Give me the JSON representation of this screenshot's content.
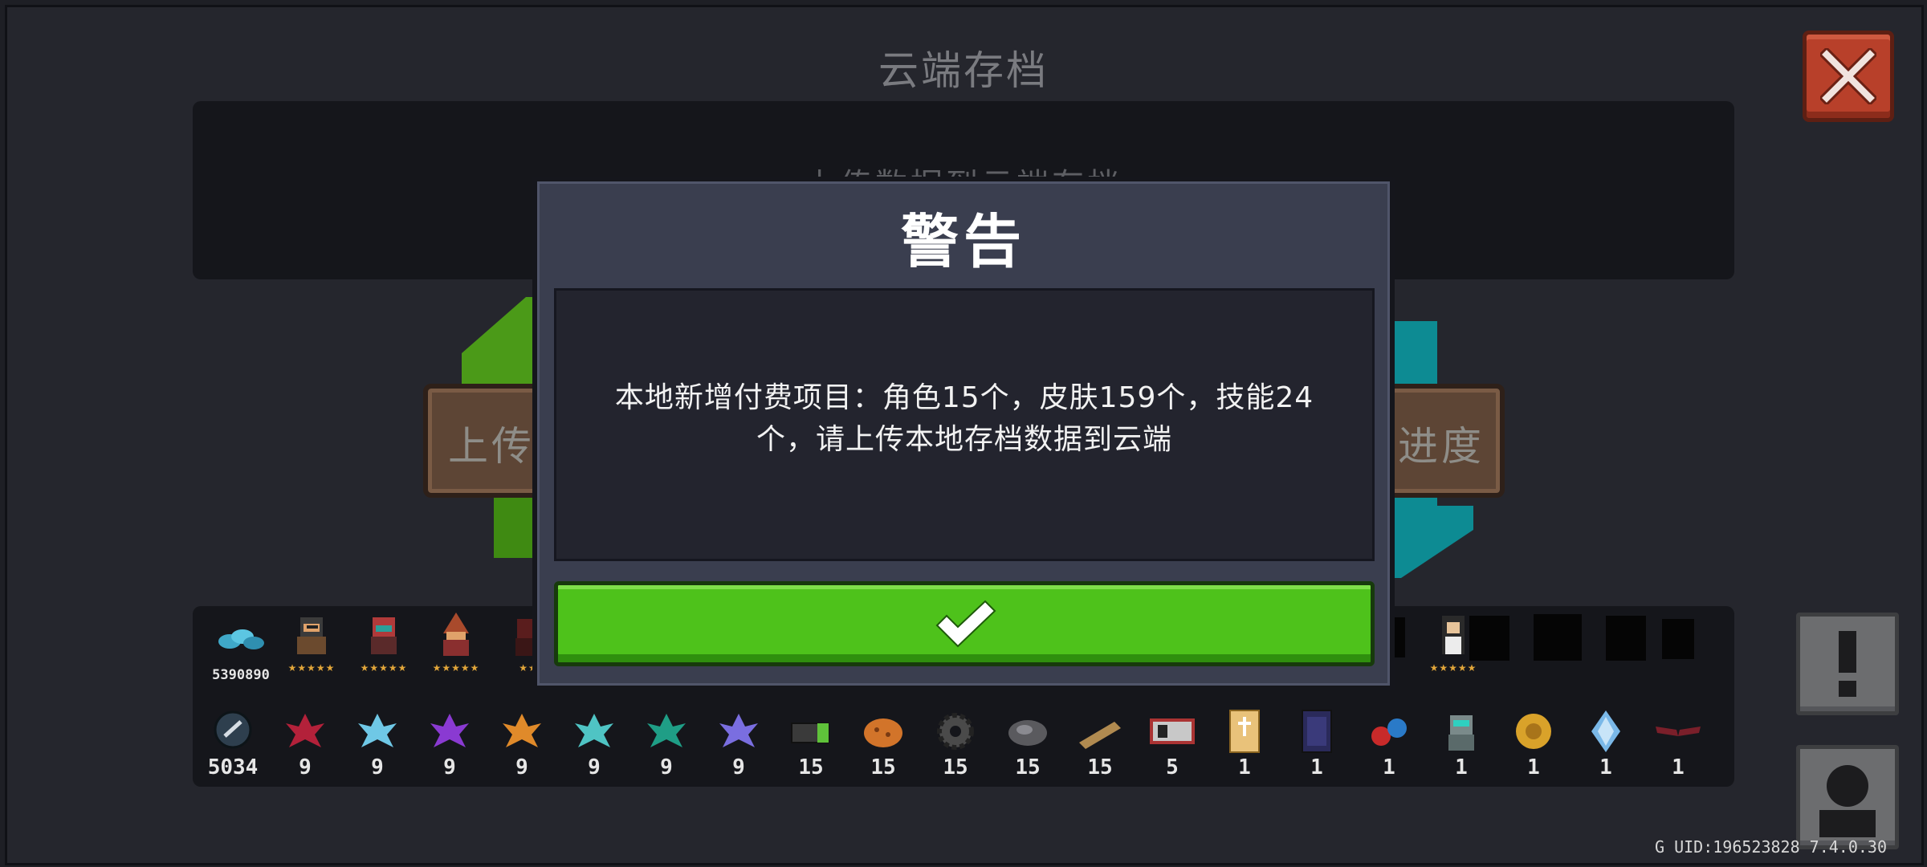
{
  "background": {
    "title": "云端存档",
    "info_text": "上传数据到云端存档",
    "upload_button_label": "上传",
    "download_button_label": "进度"
  },
  "inventory": {
    "currency": {
      "icon": "gem-stack-icon",
      "count": "5390890"
    },
    "characters": [
      {
        "icon": "knight-hero-icon",
        "rating": "★★★★★"
      },
      {
        "icon": "assassin-hero-icon",
        "rating": "★★★★★"
      },
      {
        "icon": "wizard-hero-icon",
        "rating": "★★★★★"
      },
      {
        "icon": "hero-icon",
        "rating": "★★"
      }
    ],
    "extra_character": {
      "icon": "long-hair-hero-icon",
      "rating": "★★★★★"
    },
    "materials": [
      {
        "icon": "feather-coin-icon",
        "count": "5034"
      },
      {
        "icon": "red-crystal-icon",
        "count": "9"
      },
      {
        "icon": "blue-crystal-icon",
        "count": "9"
      },
      {
        "icon": "purple-crystal-icon",
        "count": "9"
      },
      {
        "icon": "orange-crystal-icon",
        "count": "9"
      },
      {
        "icon": "cyan-crystal-icon",
        "count": "9"
      },
      {
        "icon": "teal-crystal-icon",
        "count": "9"
      },
      {
        "icon": "violet-crystal-icon",
        "count": "9"
      },
      {
        "icon": "battery-icon",
        "count": "15"
      },
      {
        "icon": "cookie-icon",
        "count": "15"
      },
      {
        "icon": "gear-icon",
        "count": "15"
      },
      {
        "icon": "ore-icon",
        "count": "15"
      },
      {
        "icon": "plank-icon",
        "count": "15"
      },
      {
        "icon": "circuit-board-icon",
        "count": "5"
      },
      {
        "icon": "holy-book-icon",
        "count": "1"
      },
      {
        "icon": "dark-book-icon",
        "count": "1"
      },
      {
        "icon": "potion-icon",
        "count": "1"
      },
      {
        "icon": "robot-icon",
        "count": "1"
      },
      {
        "icon": "gold-rune-icon",
        "count": "1"
      },
      {
        "icon": "blue-diamond-icon",
        "count": "1"
      },
      {
        "icon": "red-wings-icon",
        "count": "1"
      }
    ]
  },
  "side_buttons": {
    "alert_icon": "exclamation-icon",
    "profile_icon": "person-icon"
  },
  "footer": {
    "uid_text": "G UID:196523828 7.4.0.30"
  },
  "dialog": {
    "title": "警告",
    "message": "本地新增付费项目：角色15个，皮肤159个，技能24个，请上传本地存档数据到云端",
    "confirm_icon": "checkmark-icon"
  },
  "colors": {
    "accent_green": "#4ec21b",
    "close_red": "#b8402a",
    "dialog_bg": "#3a3e4f"
  }
}
